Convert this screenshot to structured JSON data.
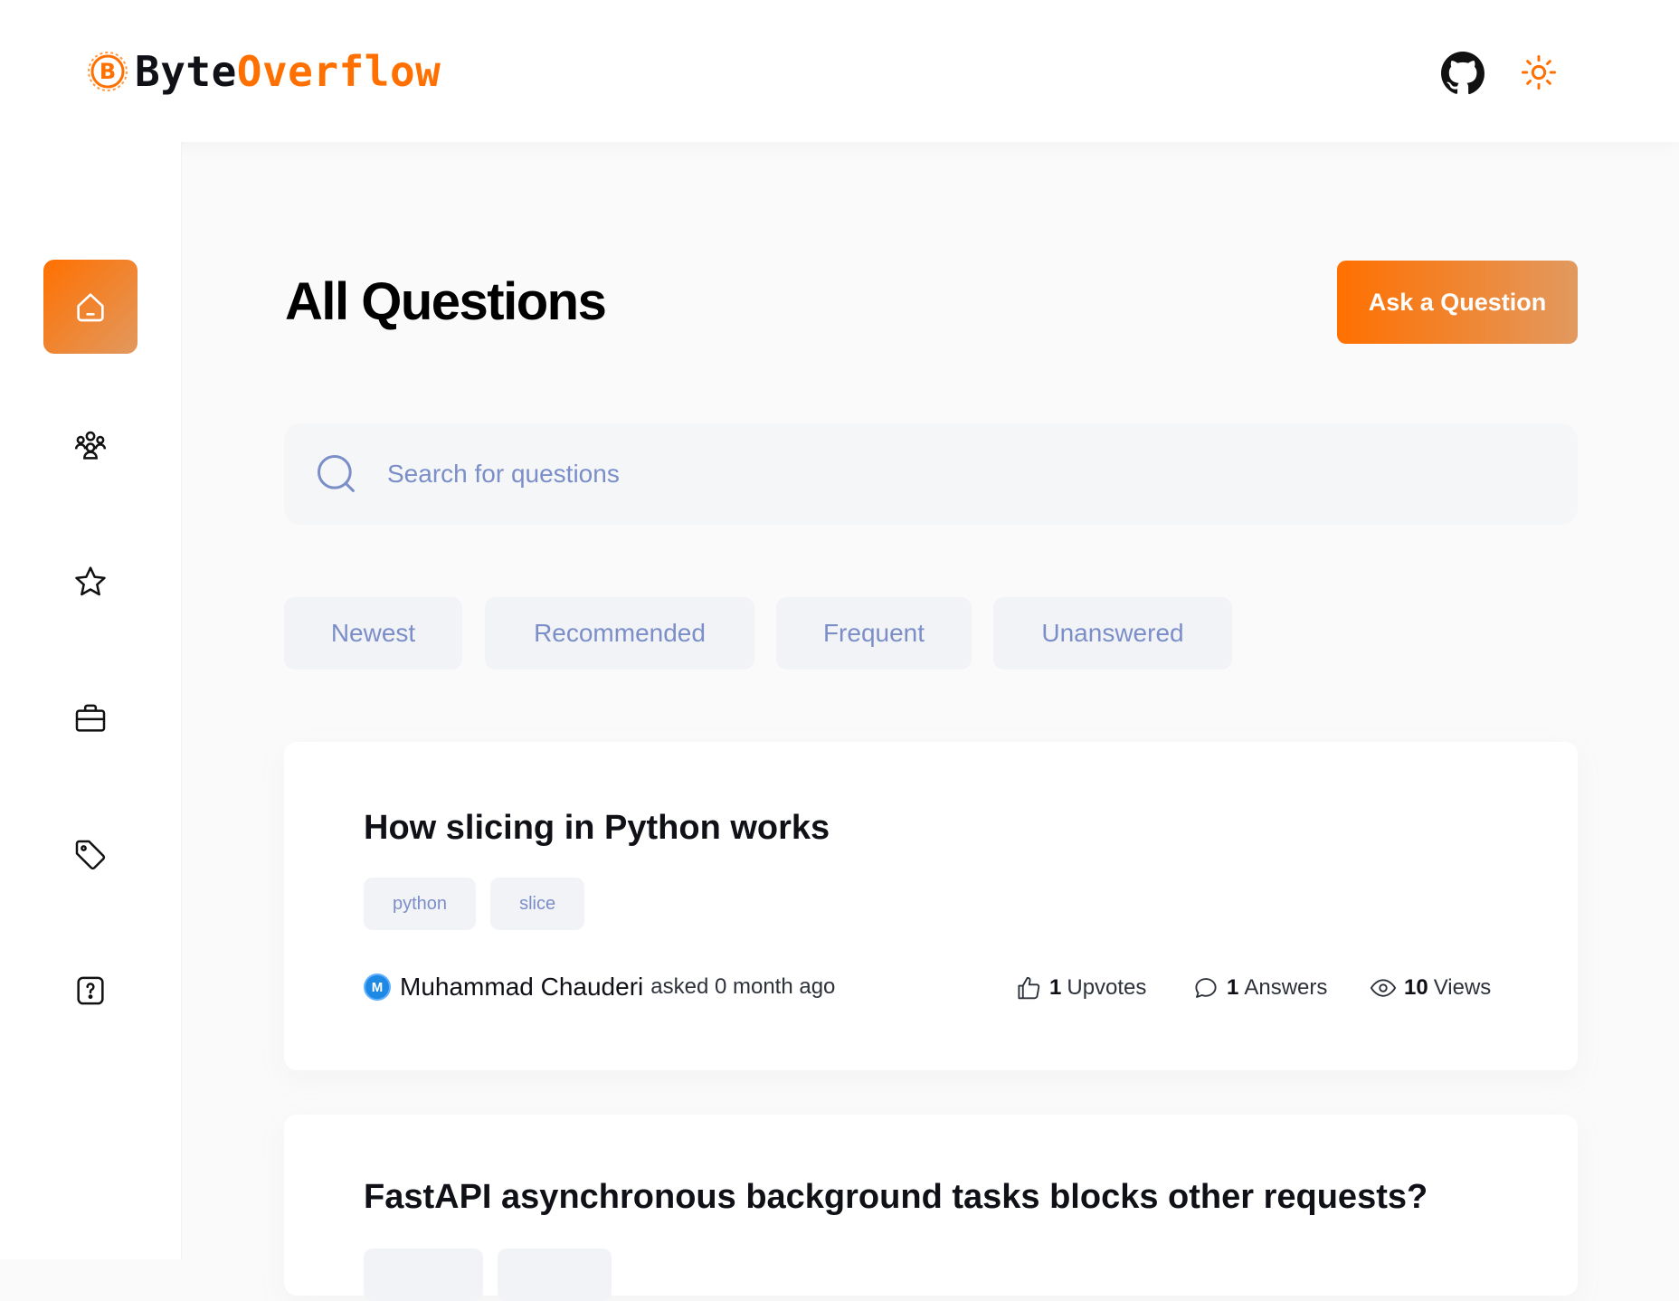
{
  "brand": {
    "part1": "Byte",
    "part2": "Overflow",
    "accent": "#ff7000"
  },
  "header_icons": [
    "github-icon",
    "sun-icon"
  ],
  "sidebar": {
    "items": [
      {
        "icon": "home-icon",
        "active": true
      },
      {
        "icon": "community-icon",
        "active": false
      },
      {
        "icon": "star-icon",
        "active": false
      },
      {
        "icon": "briefcase-icon",
        "active": false
      },
      {
        "icon": "tag-icon",
        "active": false
      },
      {
        "icon": "question-icon",
        "active": false
      }
    ]
  },
  "page": {
    "title": "All Questions",
    "ask_button": "Ask a Question",
    "search_placeholder": "Search for questions"
  },
  "filters": [
    "Newest",
    "Recommended",
    "Frequent",
    "Unanswered"
  ],
  "questions": [
    {
      "title": "How slicing in Python works",
      "tags": [
        "python",
        "slice"
      ],
      "author": "Muhammad Chauderi",
      "avatar_initial": "M",
      "asked": "asked 0 month ago",
      "upvotes": "1",
      "upvotes_label": "Upvotes",
      "answers": "1",
      "answers_label": "Answers",
      "views": "10",
      "views_label": "Views"
    },
    {
      "title": "FastAPI asynchronous background tasks blocks other requests?"
    }
  ]
}
